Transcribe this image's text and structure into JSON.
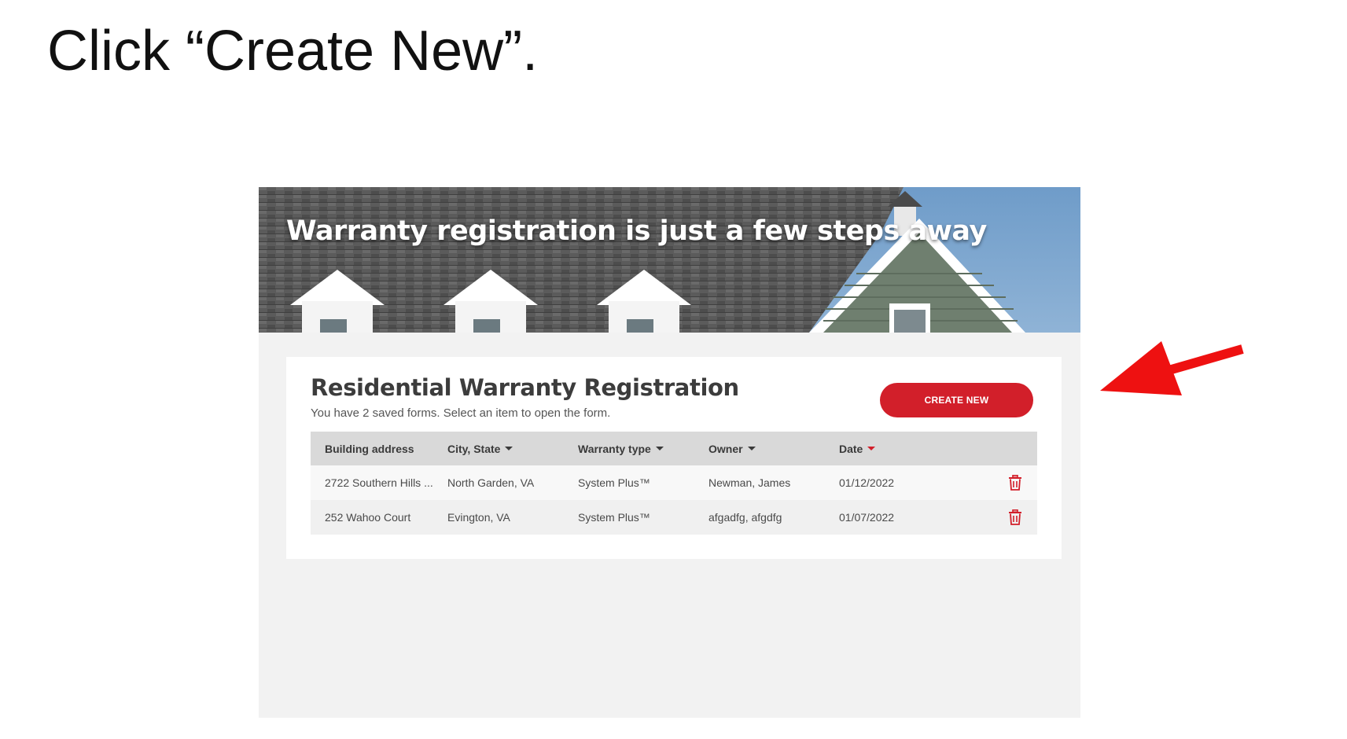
{
  "instruction": "Click “Create New”.",
  "hero": {
    "title": "Warranty registration is just a few steps away"
  },
  "card": {
    "title": "Residential Warranty Registration",
    "subtitle": "You have 2 saved forms. Select an item to open the form.",
    "create_label": "CREATE NEW"
  },
  "table": {
    "columns": [
      "Building address",
      "City, State",
      "Warranty type",
      "Owner",
      "Date"
    ],
    "rows": [
      {
        "address": "2722 Southern Hills ...",
        "city": "North Garden, VA",
        "warranty": "System Plus™",
        "owner": "Newman, James",
        "date": "01/12/2022"
      },
      {
        "address": "252 Wahoo Court",
        "city": "Evington, VA",
        "warranty": "System Plus™",
        "owner": "afgadfg, afgdfg",
        "date": "01/07/2022"
      }
    ]
  },
  "colors": {
    "accent": "#d21f2a",
    "annotation_arrow": "#ee1111"
  },
  "icons": {
    "delete": "trash-icon",
    "sort": "caret-down-icon",
    "pointer": "red-arrow-icon"
  }
}
